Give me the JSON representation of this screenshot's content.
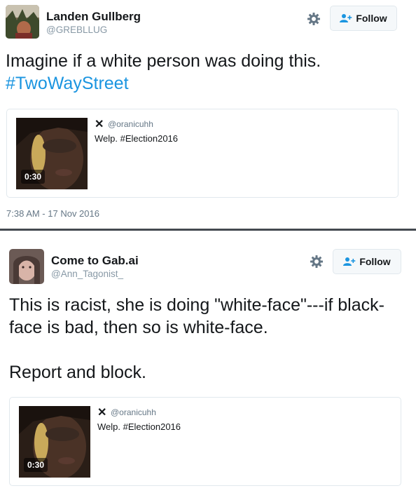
{
  "tweets": [
    {
      "display_name": "Landen Gullberg",
      "handle": "@GREBLLUG",
      "follow_label": "Follow",
      "text_line1": "Imagine if a white person was doing this.",
      "hashtag": "#TwoWayStreet",
      "quote": {
        "close_glyph": "✕",
        "handle": "@oranicuhh",
        "text": "Welp. #Election2016",
        "duration": "0:30"
      },
      "timestamp": "7:38 AM - 17 Nov 2016"
    },
    {
      "display_name": "Come to Gab.ai",
      "handle": "@Ann_Tagonist_",
      "follow_label": "Follow",
      "text_line1": "This is racist, she is doing \"white-face\"---if black-",
      "text_line2": "face is bad, then so is white-face.",
      "text_line3": "Report and block.",
      "quote": {
        "close_glyph": "✕",
        "handle": "@oranicuhh",
        "text": "Welp. #Election2016",
        "duration": "0:30"
      }
    }
  ],
  "colors": {
    "link": "#1b95e0",
    "muted": "#8899a6",
    "divider": "#444a50"
  },
  "icons": {
    "settings": "gear-icon",
    "follow": "add-user-icon",
    "close": "close-icon"
  }
}
